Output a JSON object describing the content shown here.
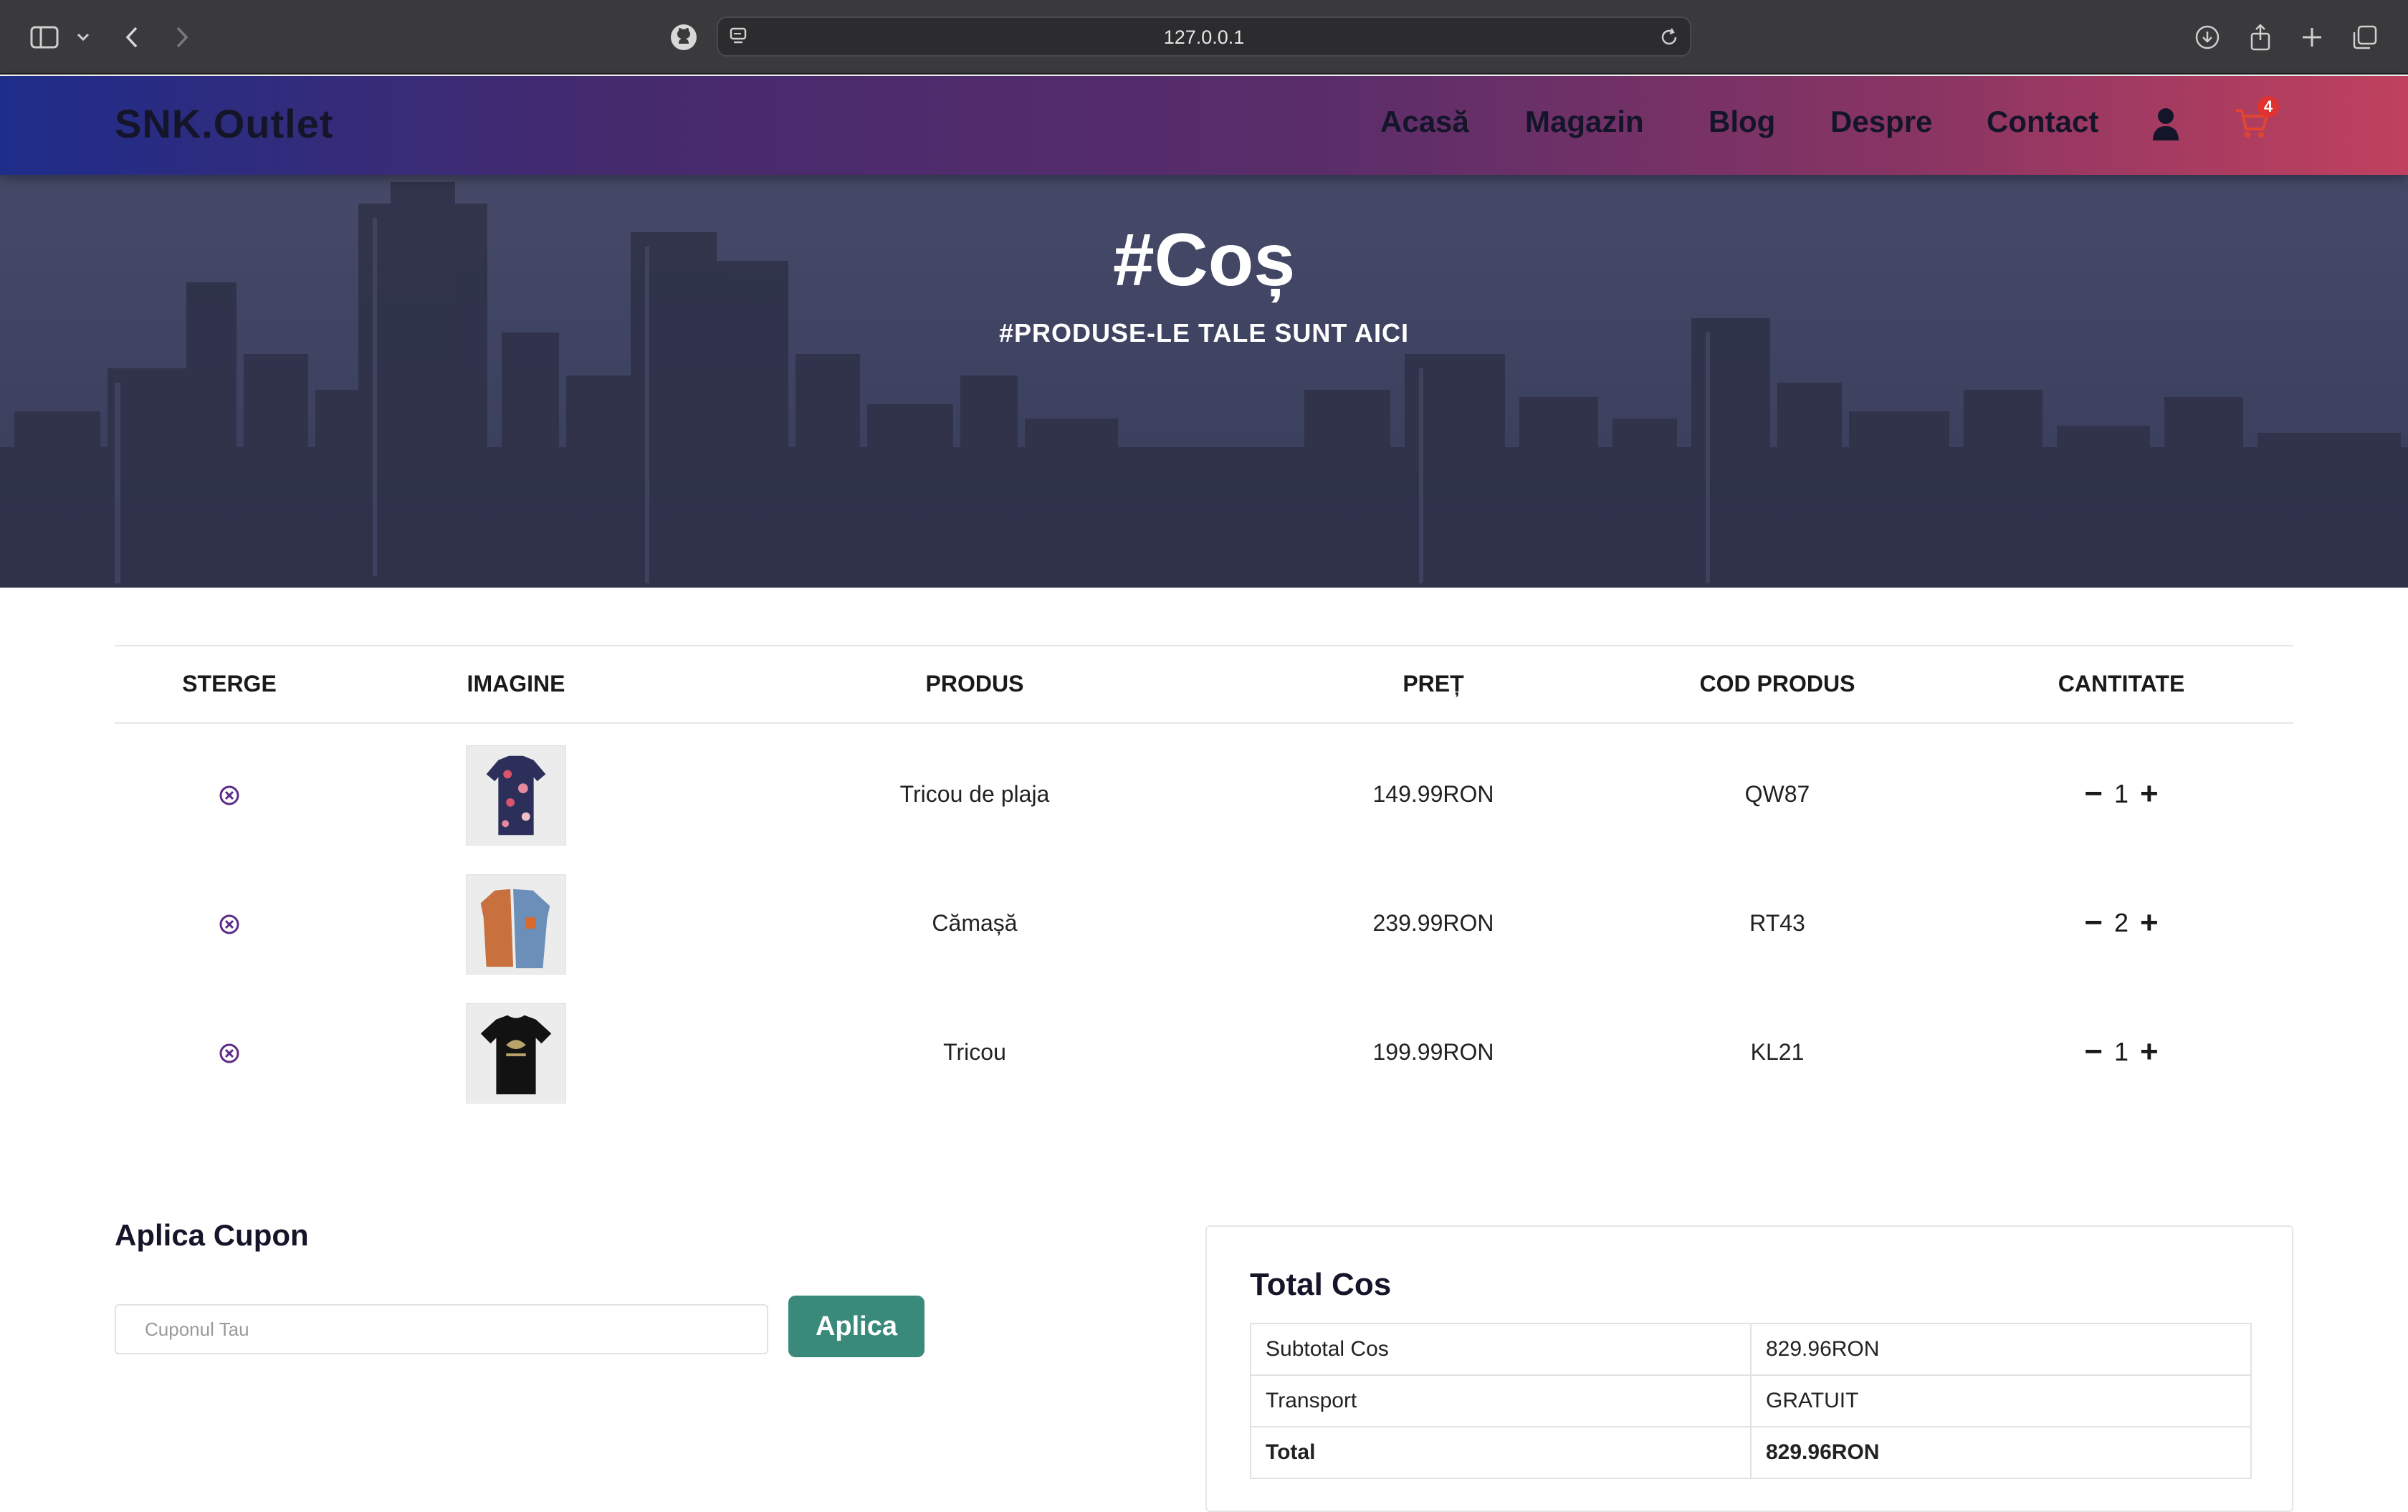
{
  "browser": {
    "url": "127.0.0.1"
  },
  "site": {
    "logo": "SNK.Outlet",
    "nav": [
      "Acasă",
      "Magazin",
      "Blog",
      "Despre",
      "Contact"
    ],
    "cart_count": "4",
    "brand_gradient": [
      "#1f2d8a",
      "#5a2d6a",
      "#c0415f"
    ],
    "accent_color": "#3a8a7c",
    "remove_color": "#5b2b86"
  },
  "hero": {
    "title": "#Coș",
    "subtitle": "#PRODUSE-LE TALE SUNT AICI"
  },
  "cart": {
    "headers": [
      "STERGE",
      "IMAGINE",
      "PRODUS",
      "PREȚ",
      "COD PRODUS",
      "CANTITATE"
    ],
    "rows": [
      {
        "product": "Tricou de plaja",
        "price": "149.99RON",
        "code": "QW87",
        "qty": "1",
        "image": "floral-shirt"
      },
      {
        "product": "Cămașă",
        "price": "239.99RON",
        "code": "RT43",
        "qty": "2",
        "image": "two-tone-shirt"
      },
      {
        "product": "Tricou",
        "price": "199.99RON",
        "code": "KL21",
        "qty": "1",
        "image": "black-tshirt"
      }
    ],
    "minus": "−",
    "plus": "+"
  },
  "coupon": {
    "title": "Aplica Cupon",
    "placeholder": "Cuponul Tau",
    "button": "Aplica"
  },
  "totals": {
    "title": "Total Cos",
    "rows": [
      {
        "label": "Subtotal Cos",
        "value": "829.96RON"
      },
      {
        "label": "Transport",
        "value": "GRATUIT"
      },
      {
        "label": "Total",
        "value": "829.96RON"
      }
    ]
  }
}
